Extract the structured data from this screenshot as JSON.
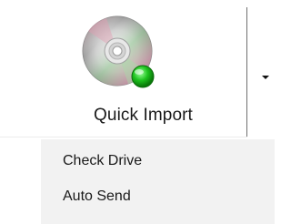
{
  "button": {
    "label": "Quick Import",
    "icon": "cd-disc-icon",
    "status_icon": "green-status-dot-icon"
  },
  "dropdown": {
    "icon": "dropdown-arrow-icon"
  },
  "menu": {
    "items": [
      {
        "label": "Check Drive"
      },
      {
        "label": "Auto Send"
      }
    ]
  },
  "colors": {
    "menu_background": "#f2f2f2",
    "separator": "#6f6f6f",
    "status_green": "#1ec31e"
  }
}
